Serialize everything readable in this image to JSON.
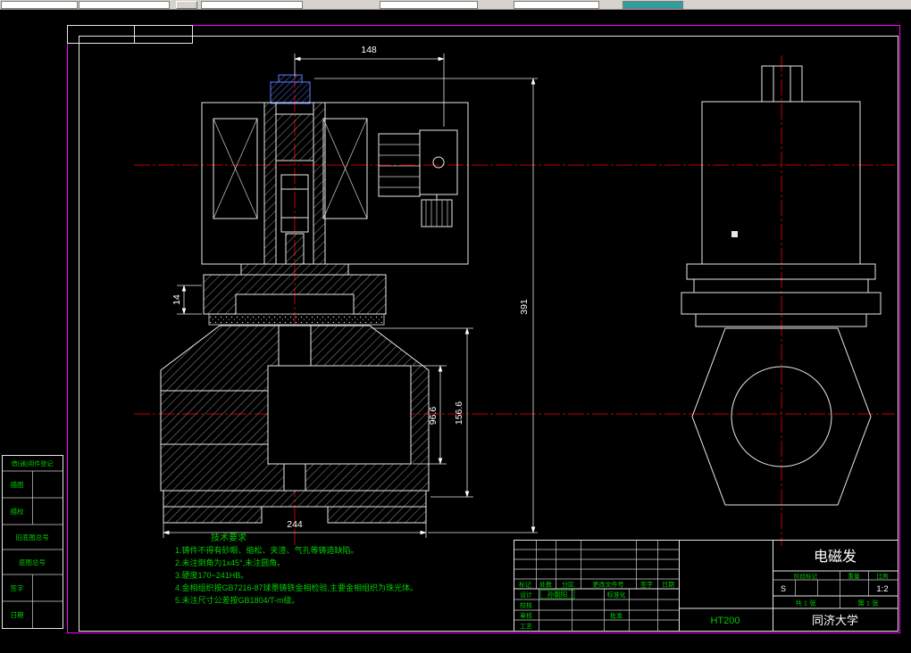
{
  "dimensions": {
    "d148": "148",
    "d391": "391",
    "d14": "14",
    "d96_6": "96.6",
    "d156_6": "156.6",
    "d244": "244"
  },
  "tech_notes": {
    "title": "技术要求",
    "line1": "1.铸件不得有砂眼、缩松、夹渣、气孔等铸造缺陷。",
    "line2": "2.未注倒角为1x45°,未注圆角。",
    "line3": "3.硬度170~241HB。",
    "line4": "4.金相组织按GB7216-87球墨铸铁金相检验,主要金相组织为珠光体。",
    "line5": "5.未注尺寸公差按GB1804/T-m级。"
  },
  "title_block": {
    "part_title": "电磁发",
    "material": "HT200",
    "company": "同济大学",
    "stage_mark": "S",
    "scale_value": "1:2",
    "header_mark": "标记",
    "header_count": "处数",
    "header_zone": "分区",
    "header_change_doc": "更改文件号",
    "header_sign": "签字",
    "header_date": "日期",
    "header_stage": "阶段标记",
    "header_weight": "重量",
    "header_scale": "比例",
    "sheets_total": "共 1 张",
    "sheets_page": "第 1 张",
    "role_design": "设计",
    "role_check": "校核",
    "role_review": "审核",
    "role_process": "工艺",
    "role_standard": "标准化",
    "role_approve": "批准",
    "designer_name": "孙朝阳"
  },
  "margin_table": {
    "row1": "借(通)用件登记",
    "row2": "描图",
    "row3": "描校",
    "row4": "旧底图总号",
    "row5": "底图总号",
    "row6": "签字",
    "row7": "日期"
  }
}
